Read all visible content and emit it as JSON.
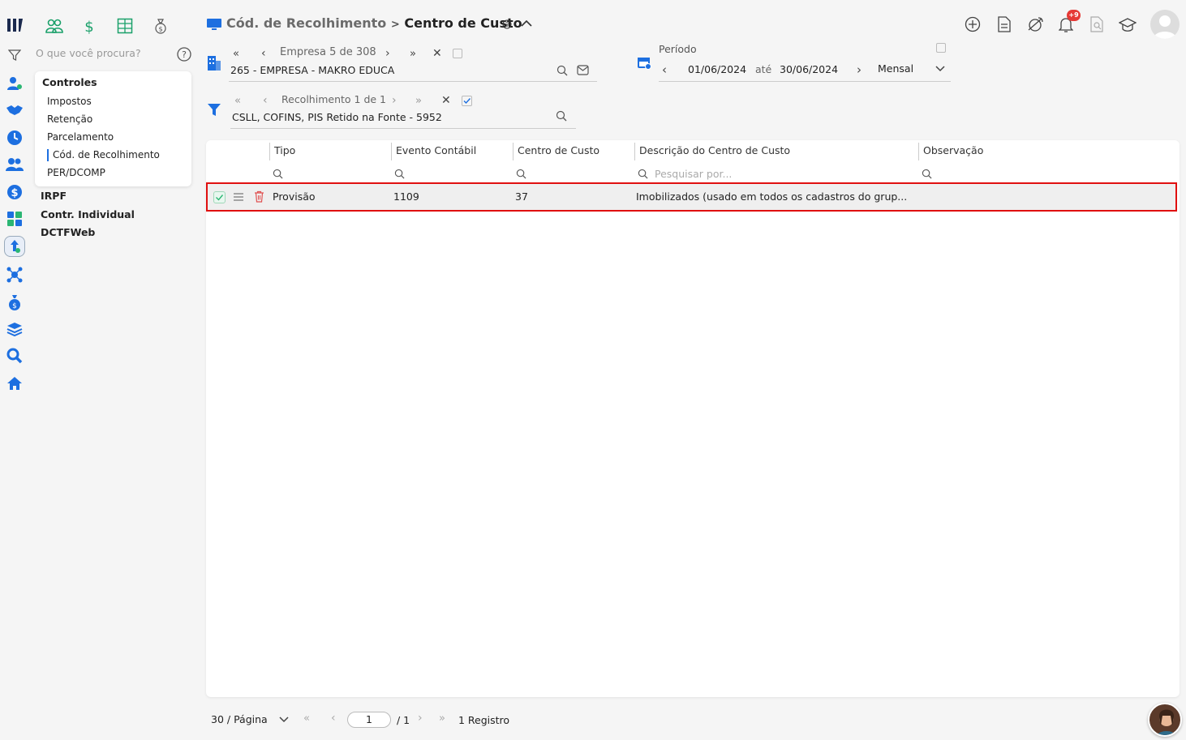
{
  "topbar": {
    "breadcrumb_parent": "Cód. de Recolhimento",
    "breadcrumb_sep": ">",
    "breadcrumb_current": "Centro de Custo",
    "notification_badge": "+9"
  },
  "sidebar": {
    "search_placeholder": "O que você procura?",
    "menu_title": "Controles",
    "menu_items": [
      "Impostos",
      "Retenção",
      "Parcelamento",
      "Cód. de Recolhimento",
      "PER/DCOMP"
    ],
    "groups": [
      "IRPF",
      "Contr. Individual",
      "DCTFWeb"
    ]
  },
  "empresa": {
    "nav_label": "Empresa",
    "nav_index": "5",
    "nav_sep": "de",
    "nav_total": "308",
    "value": "265 - EMPRESA - MAKRO EDUCA"
  },
  "periodo": {
    "label": "Período",
    "start": "01/06/2024",
    "sep": "até",
    "end": "30/06/2024",
    "mode": "Mensal"
  },
  "recolhimento": {
    "nav_label": "Recolhimento 1 de 1",
    "value": "CSLL, COFINS, PIS Retido na Fonte - 5952"
  },
  "table": {
    "columns": [
      "Tipo",
      "Evento Contábil",
      "Centro de Custo",
      "Descrição do Centro de Custo",
      "Observação"
    ],
    "search_placeholder": "Pesquisar por...",
    "rows": [
      {
        "tipo": "Provisão",
        "evento": "1109",
        "centro": "37",
        "descricao": "Imobilizados (usado em todos os cadastros do grup...",
        "observacao": ""
      }
    ]
  },
  "pagination": {
    "per_page": "30 / Página",
    "page": "1",
    "total_pages": "/ 1",
    "records": "1 Registro"
  },
  "colors": {
    "accent_green": "#1aa06a",
    "accent_blue": "#1d6fe0",
    "selection_red": "#e01010",
    "delete_red": "#e05050"
  }
}
